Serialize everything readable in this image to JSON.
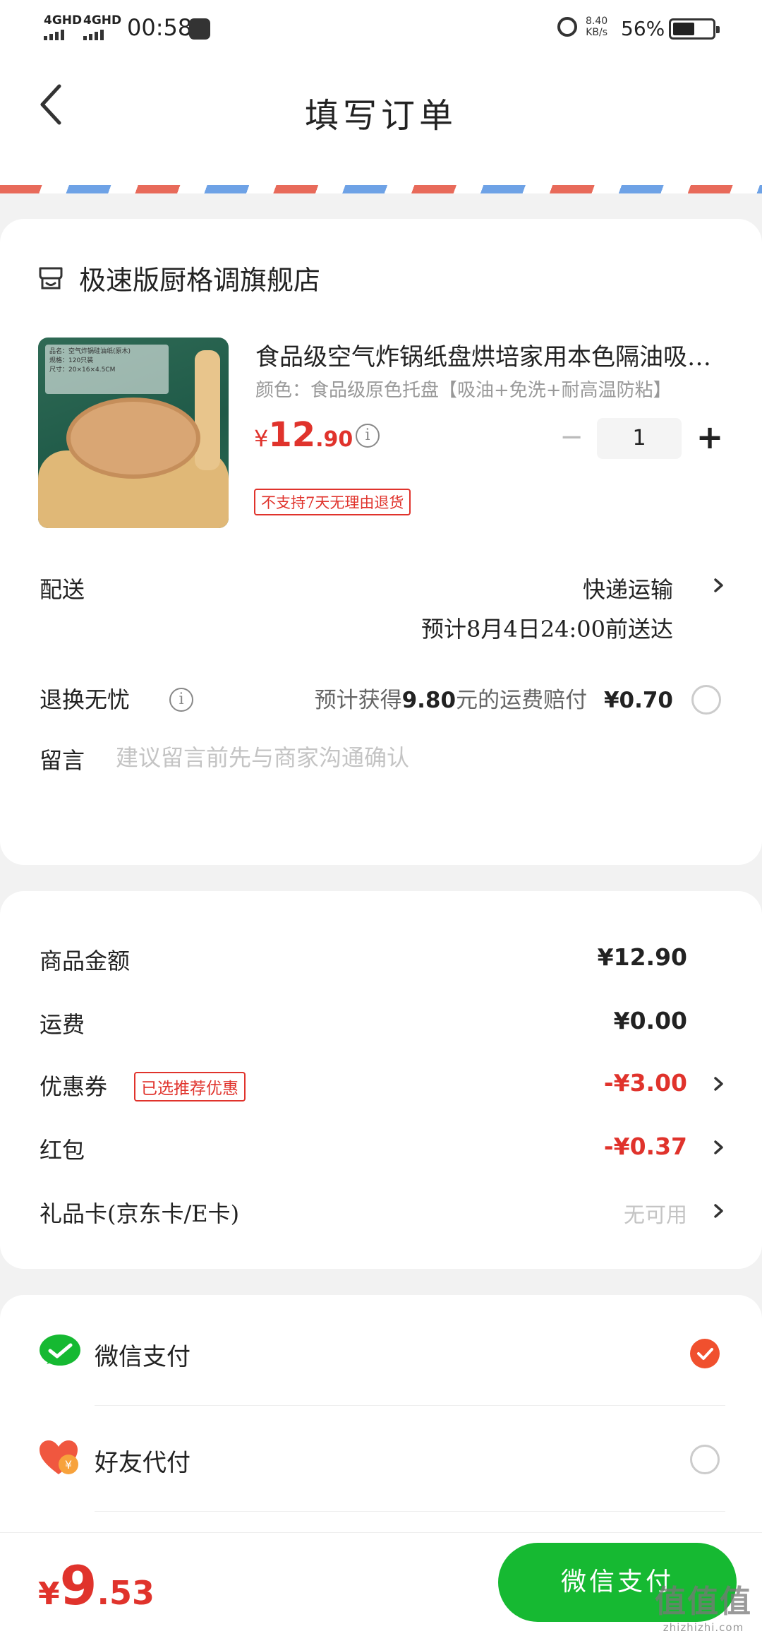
{
  "status_bar": {
    "signal1": "4GHD",
    "signal2": "4GHD",
    "time": "00:58",
    "net_speed_value": "8.40",
    "net_speed_unit": "KB/s",
    "battery_text": "56%",
    "battery_level": 0.56
  },
  "header": {
    "title": "填写订单"
  },
  "shop": {
    "name": "极速版厨格调旗舰店",
    "icon": "shop-icon"
  },
  "product": {
    "image_label_lines": [
      "品名：空气炸锅硅油纸(原木)",
      "规格：120只装",
      "尺寸：20×16×4.5CM"
    ],
    "title": "食品级空气炸锅纸盘烘培家用本色隔油吸油纸锡纸",
    "variant": "颜色：食品级原色托盘【吸油+免洗+耐高温防粘】",
    "price_currency": "¥",
    "price_int": "12",
    "price_dec": ".90",
    "quantity": "1",
    "minus": "−",
    "plus": "+",
    "return_policy": "不支持7天无理由退货"
  },
  "delivery": {
    "label": "配送",
    "method": "快递运输",
    "eta": "预计8月4日24:00前送达"
  },
  "return_insurance": {
    "label": "退换无忧",
    "desc_prefix": "预计获得",
    "desc_amount": "9.80",
    "desc_suffix": "元的运费赔付",
    "price": "¥0.70"
  },
  "message": {
    "label": "留言",
    "placeholder": "建议留言前先与商家沟通确认"
  },
  "summary": {
    "goods_label": "商品金额",
    "goods_value": "¥12.90",
    "shipping_label": "运费",
    "shipping_value": "¥0.00",
    "coupon_label": "优惠券",
    "coupon_tag": "已选推荐优惠",
    "coupon_value": "-¥3.00",
    "redpacket_label": "红包",
    "redpacket_value": "-¥0.37",
    "giftcard_label": "礼品卡(京东卡/E卡)",
    "giftcard_value": "无可用"
  },
  "payment": {
    "wechat_label": "微信支付",
    "friend_label": "好友代付"
  },
  "bottom_bar": {
    "total_currency": "¥",
    "total_int": "9",
    "total_dec": ".53",
    "pay_button": "微信支付"
  },
  "watermark": {
    "big": "值值值",
    "small": "zhizhizhi.com"
  },
  "colors": {
    "accent_red": "#e0332c",
    "wechat_green": "#16b932",
    "checked_orange": "#f0502e"
  }
}
